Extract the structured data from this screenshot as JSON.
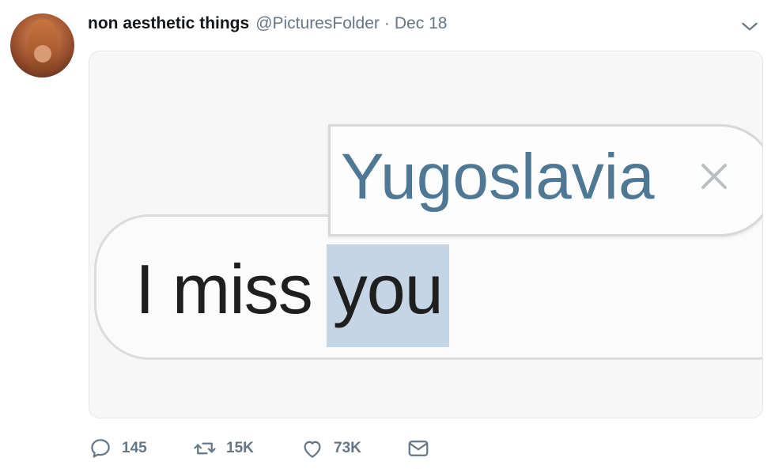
{
  "tweet": {
    "display_name": "non aesthetic things",
    "handle": "@PicturesFolder",
    "separator": "·",
    "date": "Dec 18"
  },
  "media": {
    "suggestion_text": "Yugoslavia",
    "message_text": "I miss",
    "message_highlight": "you"
  },
  "actions": {
    "replies": "145",
    "retweets": "15K",
    "likes": "73K"
  },
  "icons": [
    "chevron-down-icon",
    "reply-icon",
    "retweet-icon",
    "like-icon",
    "message-icon",
    "close-icon"
  ],
  "colors": {
    "name": "#14171a",
    "secondary": "#657786",
    "suggestion_text": "#4f7895",
    "highlight": "#c6d5e6"
  }
}
